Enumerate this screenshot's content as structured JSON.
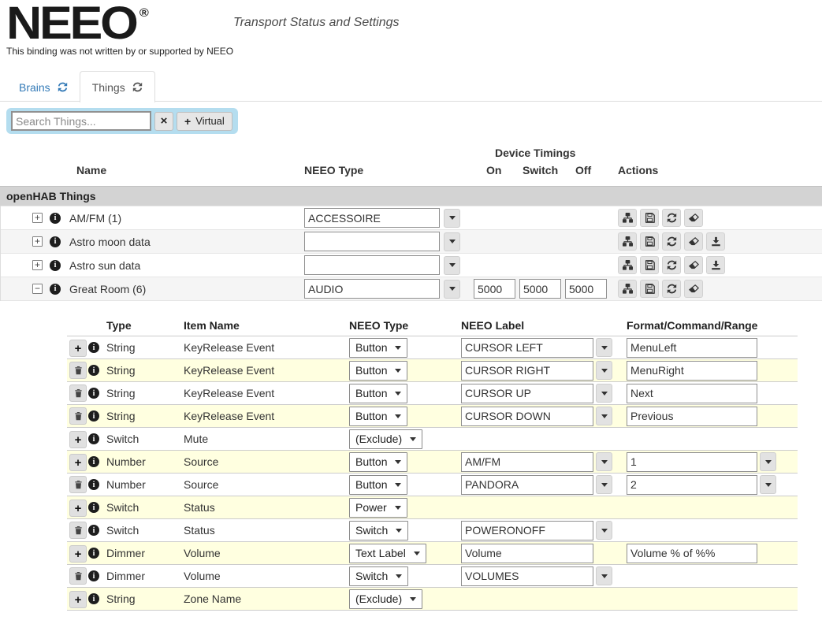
{
  "header": {
    "logo_text": "NEEO",
    "registered_mark": "®",
    "page_title": "Transport Status and Settings",
    "disclaimer": "This binding was not written by or supported by NEEO"
  },
  "tabs": {
    "brains_label": "Brains",
    "things_label": "Things"
  },
  "toolbar": {
    "search_placeholder": "Search Things...",
    "clear_icon": "x-icon",
    "virtual_button_label": "Virtual"
  },
  "things_table": {
    "headers": {
      "name": "Name",
      "neeo_type": "NEEO Type",
      "device_timings": "Device Timings",
      "on": "On",
      "switch": "Switch",
      "off": "Off",
      "actions": "Actions"
    },
    "group_label": "openHAB Things",
    "rows": [
      {
        "name": "AM/FM (1)",
        "expanded": false,
        "neeo_type": "ACCESSOIRE",
        "actions": [
          "sitemap-icon",
          "save-icon",
          "refresh-icon",
          "eraser-icon"
        ]
      },
      {
        "name": "Astro moon data",
        "expanded": false,
        "neeo_type": "",
        "actions": [
          "sitemap-icon",
          "save-icon",
          "refresh-icon",
          "eraser-icon",
          "download-icon"
        ]
      },
      {
        "name": "Astro sun data",
        "expanded": false,
        "neeo_type": "",
        "actions": [
          "sitemap-icon",
          "save-icon",
          "refresh-icon",
          "eraser-icon",
          "download-icon"
        ]
      },
      {
        "name": "Great Room (6)",
        "expanded": true,
        "neeo_type": "AUDIO",
        "timing_on": "5000",
        "timing_switch": "5000",
        "timing_off": "5000",
        "actions": [
          "sitemap-icon",
          "save-icon",
          "refresh-icon",
          "eraser-icon"
        ]
      }
    ]
  },
  "channels_table": {
    "headers": {
      "type": "Type",
      "item_name": "Item Name",
      "neeo_type": "NEEO Type",
      "neeo_label": "NEEO Label",
      "format": "Format/Command/Range"
    },
    "rows": [
      {
        "action": "add",
        "type": "String",
        "item_name": "KeyRelease Event",
        "neeo_type": "Button",
        "neeo_label": "CURSOR LEFT",
        "format": "MenuLeft"
      },
      {
        "action": "delete",
        "type": "String",
        "item_name": "KeyRelease Event",
        "neeo_type": "Button",
        "neeo_label": "CURSOR RIGHT",
        "format": "MenuRight"
      },
      {
        "action": "delete",
        "type": "String",
        "item_name": "KeyRelease Event",
        "neeo_type": "Button",
        "neeo_label": "CURSOR UP",
        "format": "Next"
      },
      {
        "action": "delete",
        "type": "String",
        "item_name": "KeyRelease Event",
        "neeo_type": "Button",
        "neeo_label": "CURSOR DOWN",
        "format": "Previous"
      },
      {
        "action": "add",
        "type": "Switch",
        "item_name": "Mute",
        "neeo_type": "(Exclude)"
      },
      {
        "action": "add",
        "type": "Number",
        "item_name": "Source",
        "neeo_type": "Button",
        "neeo_label": "AM/FM",
        "format": "1"
      },
      {
        "action": "delete",
        "type": "Number",
        "item_name": "Source",
        "neeo_type": "Button",
        "neeo_label": "PANDORA",
        "format": "2"
      },
      {
        "action": "add",
        "type": "Switch",
        "item_name": "Status",
        "neeo_type": "Power"
      },
      {
        "action": "delete",
        "type": "Switch",
        "item_name": "Status",
        "neeo_type": "Switch",
        "neeo_label": "POWERONOFF"
      },
      {
        "action": "add",
        "type": "Dimmer",
        "item_name": "Volume",
        "neeo_type": "Text Label",
        "neeo_label": "Volume",
        "format": "Volume % of %%"
      },
      {
        "action": "delete",
        "type": "Dimmer",
        "item_name": "Volume",
        "neeo_type": "Switch",
        "neeo_label": "VOLUMES"
      },
      {
        "action": "add",
        "type": "String",
        "item_name": "Zone Name",
        "neeo_type": "(Exclude)"
      }
    ]
  },
  "colors": {
    "accent_blue": "#337ab7",
    "toolbar_bg": "#b4ddef",
    "stripe_gray": "#f5f5f5",
    "stripe_yellow": "#ffffe0",
    "group_bar_bg": "#d3d3d3"
  }
}
